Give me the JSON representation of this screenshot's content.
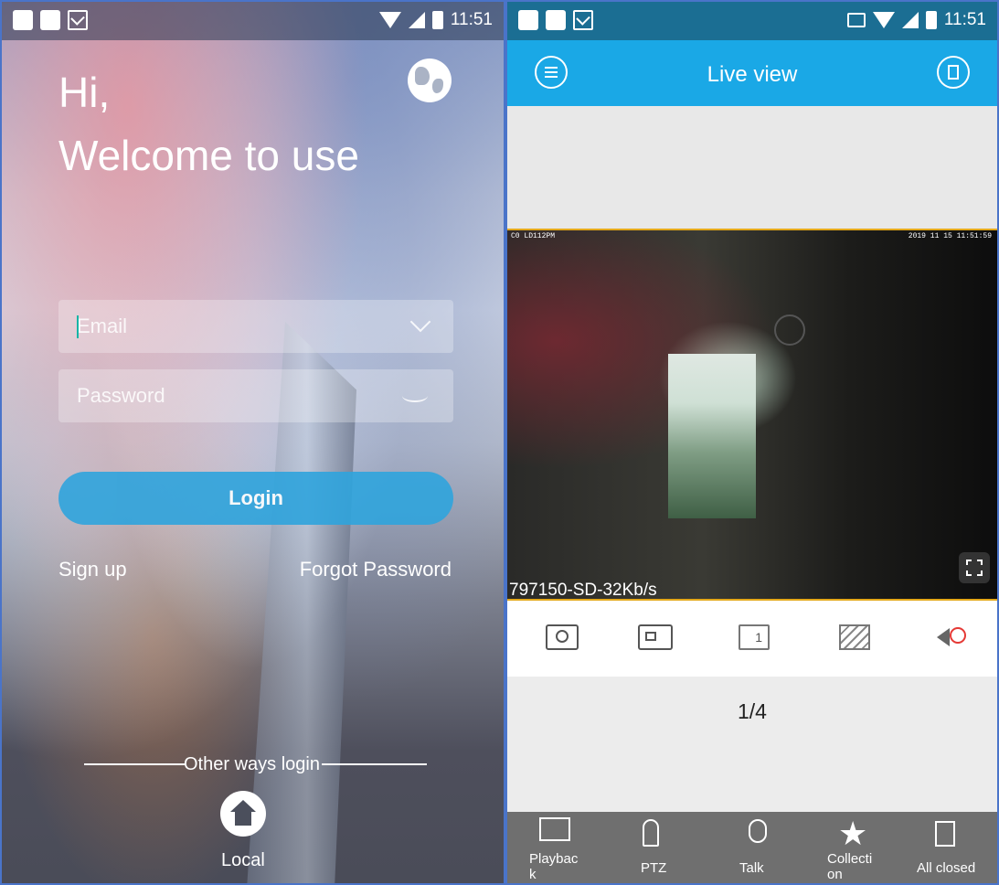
{
  "status_bar": {
    "time": "11:51"
  },
  "login": {
    "greeting": "Hi,",
    "welcome": "Welcome to use",
    "email_placeholder": "Email",
    "password_placeholder": "Password",
    "login_label": "Login",
    "signup_label": "Sign up",
    "forgot_label": "Forgot Password",
    "other_ways_label": "Other ways login",
    "local_label": "Local"
  },
  "live_view": {
    "title": "Live view",
    "osd_channel": "C0 LD112PM",
    "osd_datetime": "2019 11 15 11:51:59",
    "stream_info": "797150-SD-32Kb/s",
    "split_number": "1",
    "page_indicator": "1/4",
    "nav": [
      {
        "label": "Playbac\nk"
      },
      {
        "label": "PTZ"
      },
      {
        "label": "Talk"
      },
      {
        "label": "Collecti\non"
      },
      {
        "label": "All closed"
      }
    ]
  },
  "colors": {
    "appbar": "#1aa8e6",
    "statusbar_live": "#1b6e93",
    "login_button": "#2fa4dd",
    "video_border": "#e4a81a",
    "bottom_nav": "#6f6f6f",
    "mute_red": "#e53935"
  },
  "icons": [
    "globe-icon",
    "caret-down-icon",
    "eye-closed-icon",
    "home-icon",
    "menu-icon",
    "device-list-icon",
    "fullscreen-icon",
    "snapshot-icon",
    "record-icon",
    "split-screen-icon",
    "quality-icon",
    "mute-icon",
    "playback-icon",
    "ptz-icon",
    "talk-icon",
    "star-icon",
    "close-all-icon"
  ]
}
